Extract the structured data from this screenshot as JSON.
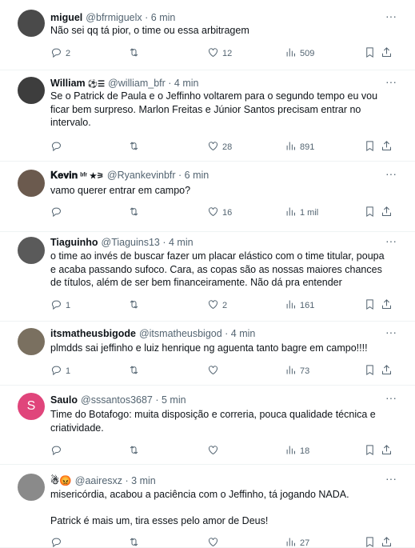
{
  "ui": {
    "more_glyph": "···"
  },
  "tweets": [
    {
      "name": "miguel",
      "badges": "",
      "handle": "@bfrmiguelx",
      "time": "6 min",
      "lines": [
        "Não sei qq tá pior, o time ou essa arbitragem"
      ],
      "replies": "2",
      "retweets": "",
      "likes": "12",
      "views": "509",
      "avatar_color": "#4a4a4a",
      "avatar_initial": ""
    },
    {
      "name": "William",
      "badges": "⚽☰",
      "handle": "@william_bfr",
      "time": "4 min",
      "lines": [
        "Se o Patrick de Paula e o Jeffinho voltarem para o segundo tempo eu vou",
        "ficar bem surpreso. Marlon Freitas e Júnior Santos precisam entrar no",
        "intervalo."
      ],
      "replies": "",
      "retweets": "",
      "likes": "28",
      "views": "891",
      "avatar_color": "#3d3d3d",
      "avatar_initial": ""
    },
    {
      "name": "𝐊𝐞𝐯𝐢𝐧",
      "badges": "ᵇᶠʳ ★⚞",
      "handle": "@Ryankevinbfr",
      "time": "6 min",
      "lines": [
        "vamo querer entrar em campo?"
      ],
      "replies": "",
      "retweets": "",
      "likes": "16",
      "views": "1 mil",
      "avatar_color": "#6b5a4e",
      "avatar_initial": ""
    },
    {
      "name": "Tiaguinho",
      "badges": "",
      "handle": "@Tiaguins13",
      "time": "4 min",
      "lines": [
        "o time ao invés de buscar fazer um placar elástico com o time titular, poupa",
        "e acaba passando sufoco. Cara, as copas são as nossas maiores chances",
        "de títulos, além de ser bem financeiramente. Não dá pra entender"
      ],
      "replies": "1",
      "retweets": "",
      "likes": "2",
      "views": "161",
      "avatar_color": "#5a5a5a",
      "avatar_initial": ""
    },
    {
      "name": "itsmatheusbigode",
      "badges": "",
      "handle": "@itsmatheusbigod",
      "time": "4 min",
      "lines": [
        "plmdds sai jeffinho e luiz henrique ng aguenta tanto bagre em campo!!!!"
      ],
      "replies": "1",
      "retweets": "",
      "likes": "",
      "views": "73",
      "avatar_color": "#7a7060",
      "avatar_initial": ""
    },
    {
      "name": "Saulo",
      "badges": "",
      "handle": "@sssantos3687",
      "time": "5 min",
      "lines": [
        "Time do Botafogo: muita disposição e correria, pouca qualidade técnica e",
        "criatividade."
      ],
      "replies": "",
      "retweets": "",
      "likes": "",
      "views": "18",
      "avatar_color": "#e0457b",
      "avatar_initial": "S"
    },
    {
      "name": "☃😡",
      "badges": "",
      "handle": "@aairesxz",
      "time": "3 min",
      "lines": [
        "misericórdia, acabou a paciência com o Jeffinho, tá jogando NADA.",
        "",
        "Patrick é mais um, tira esses pelo amor de Deus!"
      ],
      "replies": "",
      "retweets": "",
      "likes": "",
      "views": "27",
      "avatar_color": "#8a8a8a",
      "avatar_initial": ""
    }
  ]
}
